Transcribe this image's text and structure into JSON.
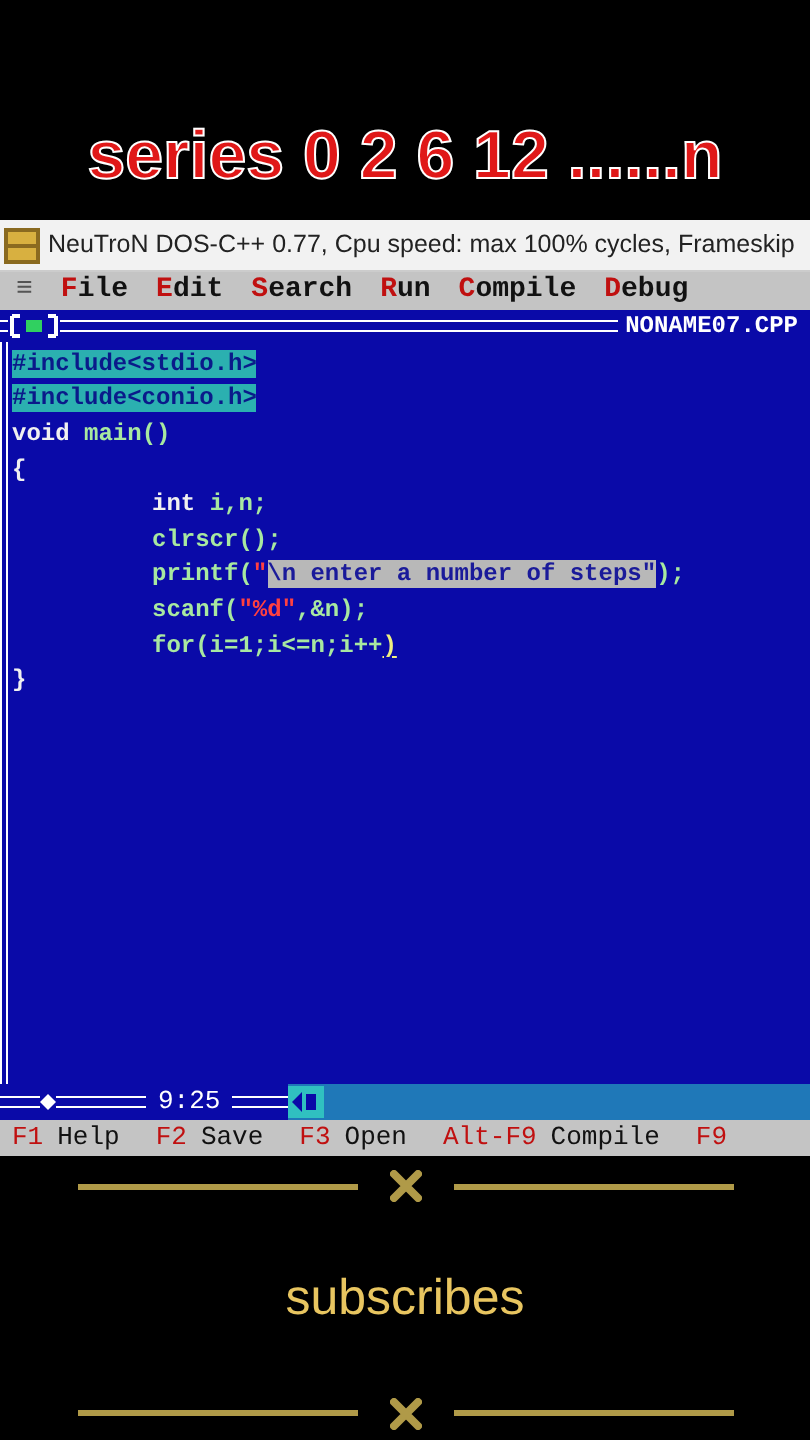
{
  "overlay_title": "series 0 2 6 12 ......n",
  "window": {
    "title": "NeuTroN DOS-C++ 0.77, Cpu speed: max 100% cycles, Frameskip"
  },
  "menu": [
    {
      "label": "≡",
      "kind": "system"
    },
    {
      "label": "File",
      "kind": "menu"
    },
    {
      "label": "Edit",
      "kind": "menu"
    },
    {
      "label": "Search",
      "kind": "menu"
    },
    {
      "label": "Run",
      "kind": "menu"
    },
    {
      "label": "Compile",
      "kind": "menu"
    },
    {
      "label": "Debug",
      "kind": "menu"
    }
  ],
  "editor": {
    "filename": "NONAME07.CPP",
    "lines": [
      {
        "indented": false,
        "segments": [
          {
            "kind": "include",
            "text": "#include<stdio.h>"
          }
        ]
      },
      {
        "indented": false,
        "segments": [
          {
            "kind": "include",
            "text": "#include<conio.h>"
          }
        ]
      },
      {
        "indented": false,
        "segments": [
          {
            "kind": "keyword",
            "text": "void "
          },
          {
            "kind": "ident",
            "text": "main()"
          }
        ]
      },
      {
        "indented": false,
        "segments": [
          {
            "kind": "keyword",
            "text": "{"
          }
        ]
      },
      {
        "indented": true,
        "segments": [
          {
            "kind": "keyword",
            "text": "int "
          },
          {
            "kind": "ident",
            "text": "i,n;"
          }
        ]
      },
      {
        "indented": true,
        "segments": [
          {
            "kind": "ident",
            "text": "clrscr();"
          }
        ]
      },
      {
        "indented": true,
        "segments": [
          {
            "kind": "ident",
            "text": "printf("
          },
          {
            "kind": "string",
            "text": "\""
          },
          {
            "kind": "selected",
            "text": "\\n enter a number of steps\""
          },
          {
            "kind": "ident",
            "text": ");"
          }
        ]
      },
      {
        "indented": true,
        "segments": [
          {
            "kind": "ident",
            "text": "scanf("
          },
          {
            "kind": "string",
            "text": "\"%d\""
          },
          {
            "kind": "ident",
            "text": ",&n);"
          }
        ]
      },
      {
        "indented": true,
        "segments": [
          {
            "kind": "ident",
            "text": "for(i=1;i<=n;i++"
          },
          {
            "kind": "cursor",
            "text": ")"
          }
        ]
      },
      {
        "indented": false,
        "segments": [
          {
            "kind": "keyword",
            "text": "}"
          }
        ]
      }
    ],
    "cursor_position": "9:25"
  },
  "status_bar": [
    {
      "key": "F1",
      "label": "Help"
    },
    {
      "key": "F2",
      "label": "Save"
    },
    {
      "key": "F3",
      "label": "Open"
    },
    {
      "key": "Alt-F9",
      "label": "Compile"
    },
    {
      "key": "F9"
    }
  ],
  "footer": {
    "text": "subscribes"
  }
}
